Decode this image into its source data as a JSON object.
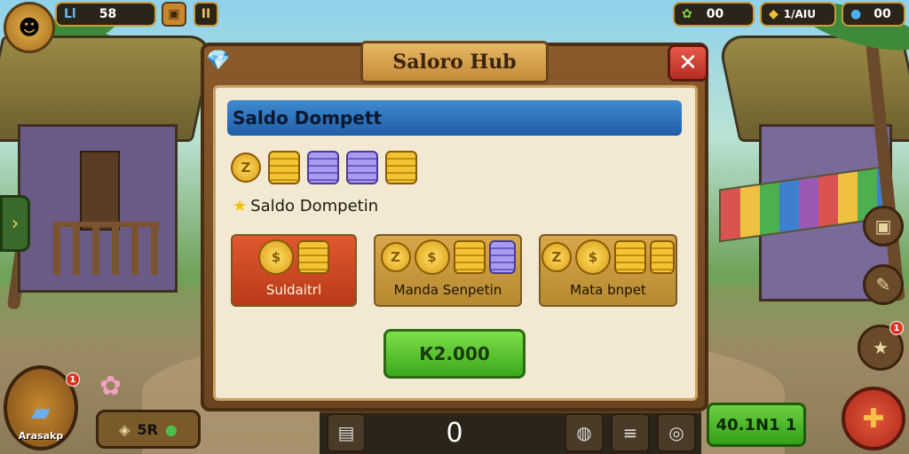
{
  "hud": {
    "level_label": "Ll",
    "level_value": "58",
    "slot1": "▣",
    "slot2": "II",
    "resource1_value": "00",
    "resource2_label": "1/AIU",
    "resource3_value": "00",
    "resource1_icon": "leaf-icon",
    "resource2_icon": "gold-pouch-icon",
    "resource3_icon": "gem-bag-icon"
  },
  "panel": {
    "title": "Salоro Hub",
    "close_symbol": "✕",
    "banner_text": "Saldo Dompett",
    "sub_label": "Saldo Dompetin",
    "cards": [
      {
        "label": "Suldaitrl",
        "color": "#c8482a"
      },
      {
        "label": "Manda Senpetin",
        "color": "#c89a3e"
      },
      {
        "label": "Mata bnpet",
        "color": "#c89a3e"
      }
    ],
    "action_button": "К2.000"
  },
  "bottom": {
    "score": "0",
    "green_pill": "40.1N1 1",
    "inventory_label": "Arasakp",
    "inventory_badge": "1",
    "pill_value": "5R",
    "right_badge": "1"
  },
  "accent_colors": {
    "banner_blue": "#1f5ea8",
    "button_green": "#3aa81a",
    "close_red": "#b42c22"
  }
}
